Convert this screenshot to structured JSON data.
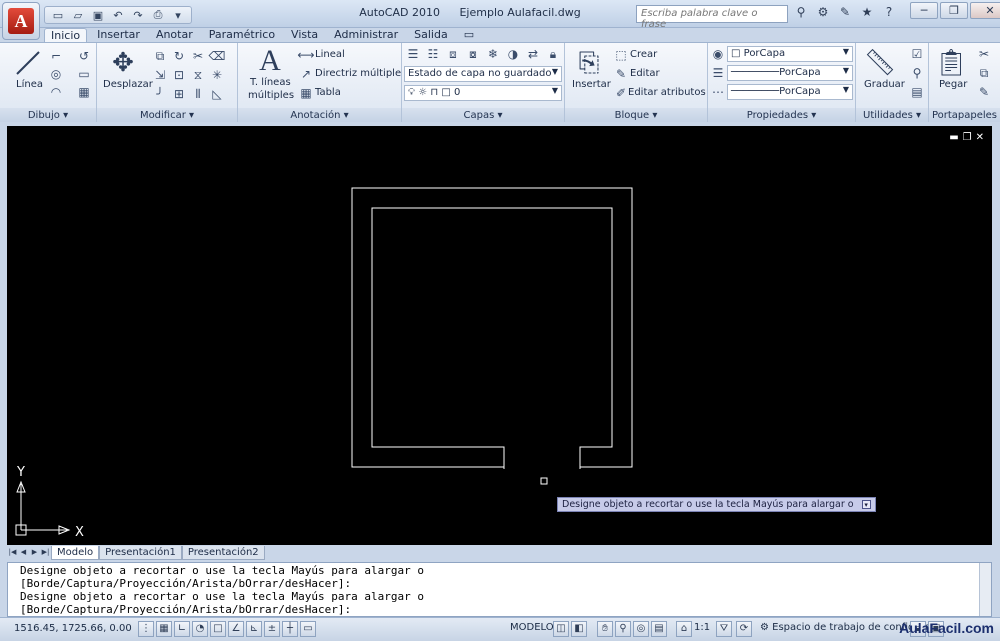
{
  "window": {
    "app_name": "AutoCAD 2010",
    "file_name": "Ejemplo Aulafacil.dwg",
    "search_placeholder": "Escriba palabra clave o frase"
  },
  "tabs": [
    "Inicio",
    "Insertar",
    "Anotar",
    "Paramétrico",
    "Vista",
    "Administrar",
    "Salida"
  ],
  "ribbon": {
    "dibujo": {
      "title": "Dibujo",
      "linea": "Línea"
    },
    "modificar": {
      "title": "Modificar",
      "desplazar": "Desplazar"
    },
    "anotacion": {
      "title": "Anotación",
      "t_lineas": "T. líneas",
      "multiples": "múltiples",
      "lineal": "Lineal",
      "directriz": "Directriz múltiple",
      "tabla": "Tabla"
    },
    "capas": {
      "title": "Capas",
      "estado": "Estado de capa no guardado",
      "capa_actual": "0"
    },
    "bloque": {
      "title": "Bloque",
      "insertar": "Insertar",
      "crear": "Crear",
      "editar": "Editar",
      "editar_atributos": "Editar atributos"
    },
    "propiedades": {
      "title": "Propiedades",
      "color": "PorCapa",
      "tipo_linea": "PorCapa",
      "grosor": "PorCapa"
    },
    "utilidades": {
      "title": "Utilidades",
      "graduar": "Graduar"
    },
    "portapapeles": {
      "title": "Portapapeles",
      "pegar": "Pegar"
    }
  },
  "canvas": {
    "tooltip": "Designe objeto a recortar o use la tecla Mayús para alargar o",
    "axis_x": "X",
    "axis_y": "Y"
  },
  "layout_tabs": [
    "Modelo",
    "Presentación1",
    "Presentación2"
  ],
  "command_lines": [
    "Designe objeto a recortar o use la tecla Mayús para alargar o",
    "[Borde/Captura/Proyección/Arista/bOrrar/desHacer]:",
    "Designe objeto a recortar o use la tecla Mayús para alargar o",
    "[Borde/Captura/Proyección/Arista/bOrrar/desHacer]:"
  ],
  "status": {
    "coords": "1516.45, 1725.66, 0.00",
    "modelo": "MODELO",
    "scale": "1:1",
    "workspace": "Espacio de trabajo de configura"
  },
  "watermark": "AulaFacil.com"
}
